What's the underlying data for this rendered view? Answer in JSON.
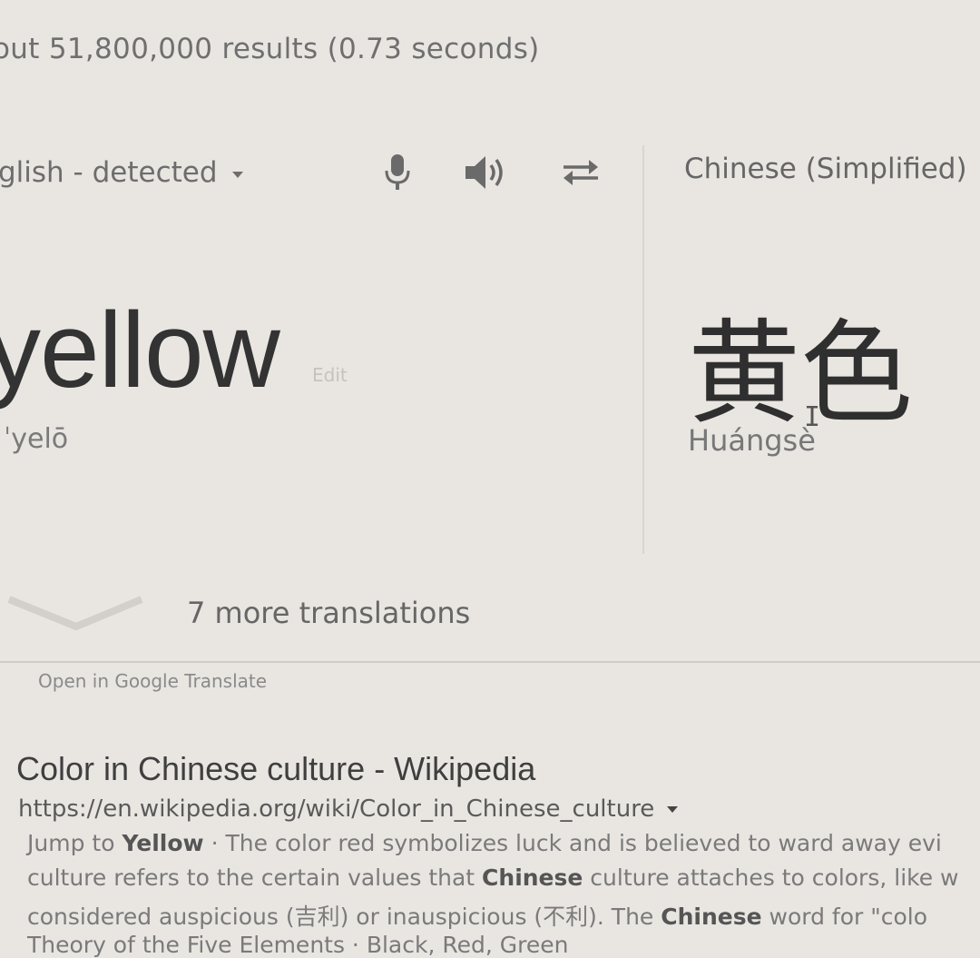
{
  "search": {
    "result_stats": "out 51,800,000 results (0.73 seconds)"
  },
  "translate": {
    "source_language": "glish - detected",
    "target_language": "Chinese (Simplified)",
    "source_text": "yellow",
    "edit_label": "Edit",
    "source_transliteration": "ˈyelō",
    "target_text": "黄色",
    "target_romanization": "Huángsè",
    "more_translations": "7 more translations",
    "open_link": "Open in Google Translate",
    "icons": [
      "microphone-icon",
      "speaker-icon",
      "swap-icon",
      "chevron-down-icon"
    ]
  },
  "result": {
    "title": "Color in Chinese culture - Wikipedia",
    "url": "https://en.wikipedia.org/wiki/Color_in_Chinese_culture",
    "snippet": {
      "line1_prefix": "Jump to ",
      "line1_bold": "Yellow",
      "line1_rest": " · The color red symbolizes luck and is believed to ward away evi",
      "line2_prefix": "culture refers to the certain values that ",
      "line2_bold": "Chinese",
      "line2_rest": " culture attaches to colors, like w",
      "line3_prefix": "considered auspicious (吉利) or inauspicious (不利). The ",
      "line3_bold": "Chinese",
      "line3_rest": " word for \"colo",
      "line4": "Theory of the Five Elements · Black, Red, Green"
    }
  },
  "colors": {
    "background": "#e9e6e2",
    "text_dark": "#333333",
    "text_muted": "#7a7a7a"
  }
}
